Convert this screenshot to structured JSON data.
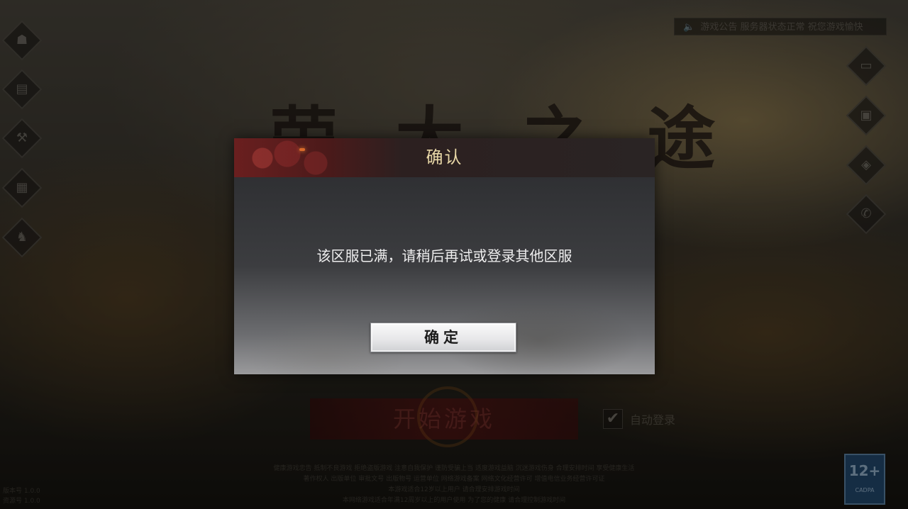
{
  "background": {
    "game_title": "荣 大 之 途",
    "notice_text": "游戏公告 服务器状态正常 祝您游戏愉快",
    "speaker_icon": "speaker-icon",
    "left_menu_icons": [
      "mask-icon",
      "book-icon",
      "hammer-icon",
      "scroll-icon",
      "helmet-icon"
    ],
    "left_menu_glyphs": [
      "☗",
      "▤",
      "⚒",
      "▦",
      "♞"
    ],
    "right_menu_icons": [
      "notice-icon",
      "gift-icon",
      "service-icon",
      "phone-icon"
    ],
    "right_menu_glyphs": [
      "▭",
      "▣",
      "◈",
      "✆"
    ],
    "start_button_label": "开始游戏",
    "auto_login_label": "自动登录",
    "auto_login_checked": true,
    "footer_lines": [
      "健康游戏忠告 抵制不良游戏 拒绝盗版游戏 注意自我保护 谨防受骗上当 适度游戏益脑 沉迷游戏伤身 合理安排时间 享受健康生活",
      "著作权人 出版单位 审批文号 出版物号 运营单位 网络游戏备案 网络文化经营许可 增值电信业务经营许可证",
      "本游戏适合12岁以上用户 请合理安排游戏时间",
      "本网络游戏适合年满12周岁以上的用户使用 为了您的健康 请合理控制游戏时间"
    ],
    "version_lines": [
      "版本号 1.0.0",
      "资源号 1.0.0"
    ],
    "age_rating": "12+",
    "age_rating_sub": "CADPA"
  },
  "dialog": {
    "title": "确认",
    "message": "该区服已满，请稍后再试或登录其他区服",
    "confirm_label": "确定"
  },
  "colors": {
    "dialog_title": "#e7d6a6",
    "header_red": "#6a1f1f",
    "button_face": "#fafafa"
  }
}
